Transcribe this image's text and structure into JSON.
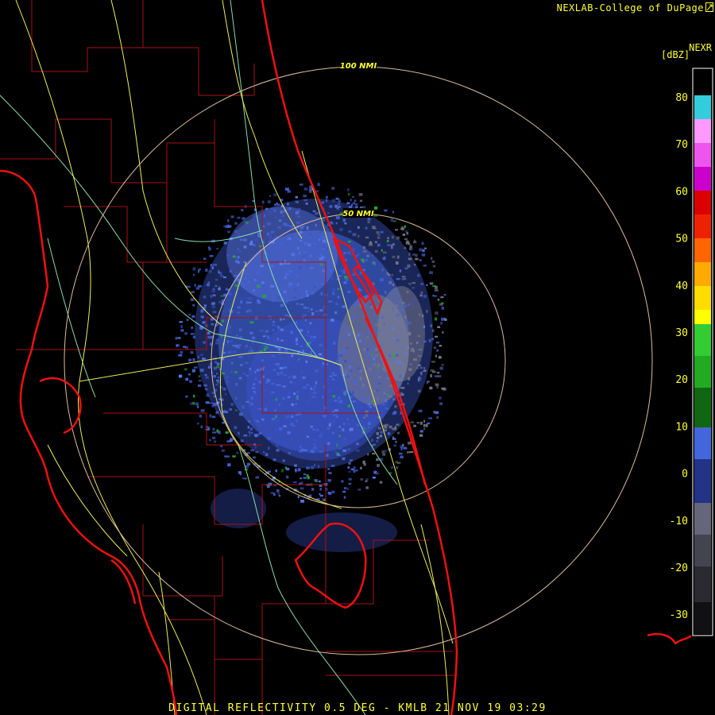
{
  "header": {
    "credit": "NEXLAB-College of DuPage"
  },
  "icons": {
    "logo": "corner-arrow-icon"
  },
  "colorbar": {
    "product": "NEXR",
    "unit": "[dBZ]",
    "ticks": [
      "80",
      "70",
      "60",
      "50",
      "40",
      "30",
      "20",
      "10",
      "0",
      "-10",
      "-20",
      "-30"
    ]
  },
  "rings": {
    "inner": "50 NMI",
    "outer": "100 NMI"
  },
  "footer": {
    "caption": "DIGITAL REFLECTIVITY 0.5 DEG - KMLB 21 NOV 19 03:29"
  },
  "colors": {
    "coast": "#ee1111",
    "roads": "#eeee55",
    "rivers": "#88ddaa",
    "counties": "#aa1111",
    "rings": "#ddbb99",
    "echo_light": "#4466dd",
    "echo_clutter": "#77778a",
    "echo_green": "#22aa33"
  }
}
